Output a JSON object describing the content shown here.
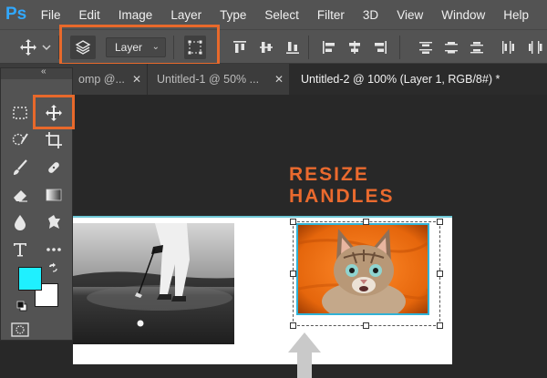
{
  "app": {
    "logo": "Ps"
  },
  "menubar": {
    "items": [
      "File",
      "Edit",
      "Image",
      "Layer",
      "Type",
      "Select",
      "Filter",
      "3D",
      "View",
      "Window",
      "Help"
    ]
  },
  "options_bar": {
    "layer_select": "Layer"
  },
  "tabs": [
    {
      "label": "omp @...",
      "active": false
    },
    {
      "label": "Untitled-1 @ 50% ...",
      "active": false
    },
    {
      "label": "Untitled-2 @ 100% (Layer 1, RGB/8#) *",
      "active": true
    }
  ],
  "annotation": {
    "text": "RESIZE\nHANDLES"
  },
  "colors": {
    "foreground": "#1ff0ff",
    "background": "#ffffff",
    "highlight": "#e8692b",
    "accent": "#31a8ff"
  }
}
